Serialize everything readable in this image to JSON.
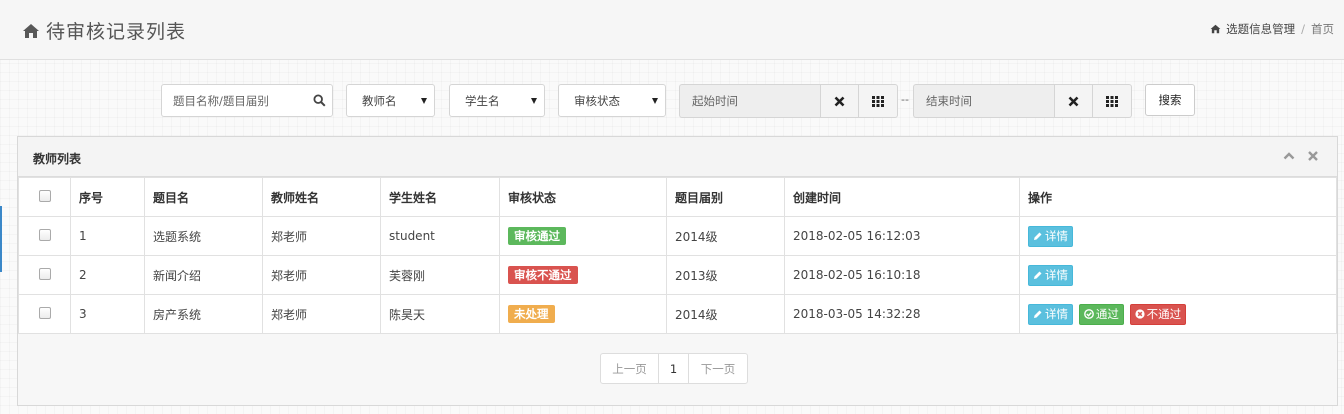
{
  "header": {
    "title": "待审核记录列表",
    "breadcrumb": {
      "section": "选题信息管理",
      "current": "首页"
    }
  },
  "toolbar": {
    "search_placeholder": "题目名称/题目届别",
    "teacher_select": "教师名",
    "student_select": "学生名",
    "status_select": "审核状态",
    "start_time_placeholder": "起始时间",
    "end_time_placeholder": "结束时间",
    "range_separator": "--",
    "search_button": "搜索"
  },
  "panel": {
    "title": "教师列表",
    "columns": [
      "序号",
      "题目名",
      "教师姓名",
      "学生姓名",
      "审核状态",
      "题目届别",
      "创建时间",
      "操作"
    ],
    "rows": [
      {
        "seq": "1",
        "topic": "选题系统",
        "teacher": "郑老师",
        "student": "student",
        "status": "审核通过",
        "status_type": "pass",
        "grade": "2014级",
        "created": "2018-02-05 16:12:03",
        "actions": [
          "详情"
        ]
      },
      {
        "seq": "2",
        "topic": "新闻介绍",
        "teacher": "郑老师",
        "student": "芙蓉刚",
        "status": "审核不通过",
        "status_type": "fail",
        "grade": "2013级",
        "created": "2018-02-05 16:10:18",
        "actions": [
          "详情"
        ]
      },
      {
        "seq": "3",
        "topic": "房产系统",
        "teacher": "郑老师",
        "student": "陈昊天",
        "status": "未处理",
        "status_type": "pending",
        "grade": "2014级",
        "created": "2018-03-05 14:32:28",
        "actions": [
          "详情",
          "通过",
          "不通过"
        ]
      }
    ]
  },
  "pagination": {
    "prev": "上一页",
    "current": "1",
    "next": "下一页"
  },
  "colors": {
    "pass": "#5cb85c",
    "fail": "#d9534f",
    "pending": "#f0ad4e",
    "info": "#5bc0de"
  }
}
